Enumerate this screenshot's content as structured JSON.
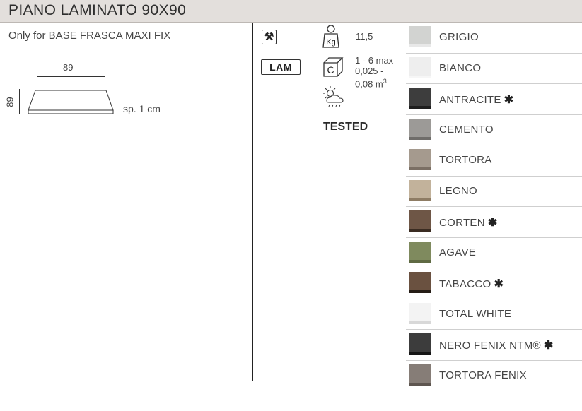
{
  "title": "PIANO LAMINATO 90X90",
  "compatibility": "Only for BASE FRASCA MAXI FIX",
  "dimensions": {
    "width_label": "89",
    "depth_label": "89",
    "thickness_label": "sp. 1 cm"
  },
  "badge": {
    "lam": "LAM"
  },
  "specs": {
    "weight_unit": "Kg",
    "weight": "11,5",
    "carton_letter": "C",
    "carton_line1": "1 - 6 max",
    "carton_line2": "0,025 -",
    "carton_line3": "0,08 m",
    "carton_line3_sup": "3",
    "tested": "TESTED"
  },
  "finishes": [
    {
      "name": "GRIGIO",
      "star": "",
      "color": "#d2d3d1",
      "base": "#e8e8e8"
    },
    {
      "name": "BIANCO",
      "star": "",
      "color": "#eeeeee",
      "base": "#f6f6f6"
    },
    {
      "name": "ANTRACITE",
      "star": "✱",
      "color": "#3d3d3d",
      "base": "#1e1e1e"
    },
    {
      "name": "CEMENTO",
      "star": "",
      "color": "#9c9a97",
      "base": "#6f6d6a"
    },
    {
      "name": "TORTORA",
      "star": "",
      "color": "#a59a8e",
      "base": "#7b6f64"
    },
    {
      "name": "LEGNO",
      "star": "",
      "color": "#c2b29b",
      "base": "#8e7c64"
    },
    {
      "name": "CORTEN",
      "star": "✱",
      "color": "#6e5646",
      "base": "#3a2c22"
    },
    {
      "name": "AGAVE",
      "star": "",
      "color": "#7f8a5e",
      "base": "#5f6a43"
    },
    {
      "name": "TABACCO",
      "star": "✱",
      "color": "#6a5140",
      "base": "#251c16"
    },
    {
      "name": "TOTAL WHITE",
      "star": "",
      "color": "#f3f3f3",
      "base": "#d8d8d8"
    },
    {
      "name": "NERO FENIX NTM®",
      "star": "✱",
      "color": "#3c3c3c",
      "base": "#161616"
    },
    {
      "name": "TORTORA FENIX",
      "star": "",
      "color": "#867d77",
      "base": "#5e5650"
    }
  ]
}
